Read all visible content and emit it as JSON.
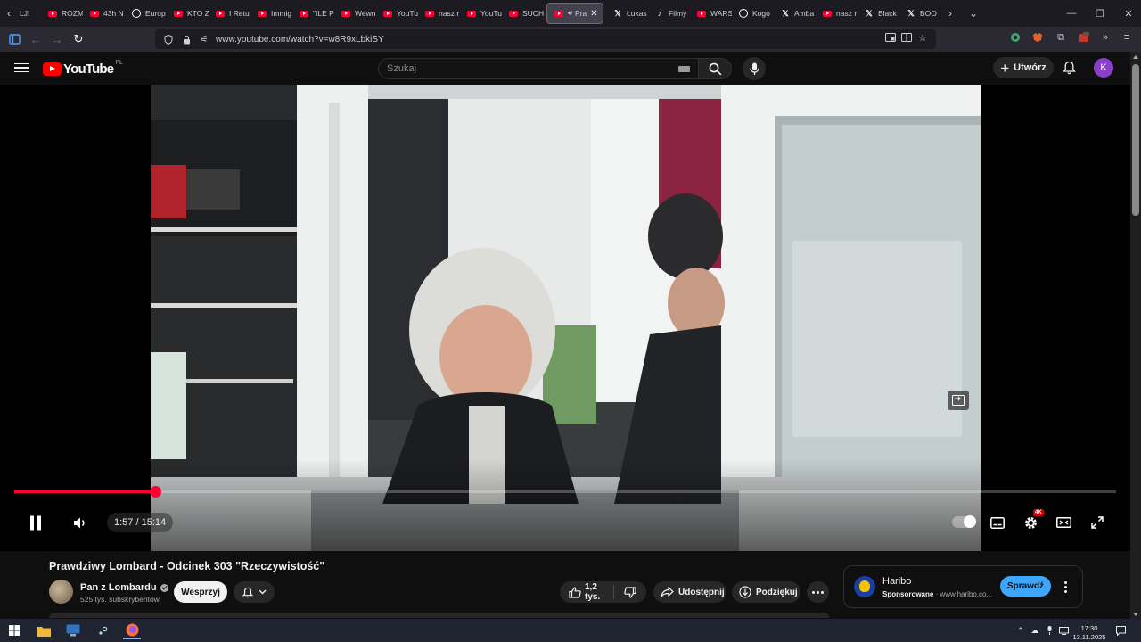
{
  "browser": {
    "tabs": [
      {
        "label": "LJ!",
        "icon": "scroll-left-icon"
      },
      {
        "label": "ROZM",
        "icon": "youtube-favicon"
      },
      {
        "label": "43h N",
        "icon": "youtube-favicon"
      },
      {
        "label": "Europ",
        "icon": "circle-favicon"
      },
      {
        "label": "KTO Z",
        "icon": "youtube-favicon"
      },
      {
        "label": "I Retu",
        "icon": "youtube-favicon"
      },
      {
        "label": "Immig",
        "icon": "youtube-favicon"
      },
      {
        "label": "\"ILE P",
        "icon": "youtube-favicon"
      },
      {
        "label": "Wewn",
        "icon": "youtube-favicon"
      },
      {
        "label": "YouTu",
        "icon": "youtube-favicon"
      },
      {
        "label": "nasz r",
        "icon": "youtube-favicon"
      },
      {
        "label": "YouTu",
        "icon": "youtube-favicon"
      },
      {
        "label": "SUCH",
        "icon": "youtube-favicon"
      },
      {
        "label": "Pra",
        "icon": "youtube-favicon",
        "active": true
      },
      {
        "label": "Łukas",
        "icon": "x-favicon"
      },
      {
        "label": "Filmy",
        "icon": "tiktok-favicon"
      },
      {
        "label": "WARS",
        "icon": "youtube-favicon"
      },
      {
        "label": "Kogo",
        "icon": "circle-favicon"
      },
      {
        "label": "Amba",
        "icon": "x-favicon"
      },
      {
        "label": "nasz r",
        "icon": "youtube-favicon"
      },
      {
        "label": "Black",
        "icon": "x-favicon"
      },
      {
        "label": "BOO",
        "icon": "x-favicon"
      }
    ],
    "url": "www.youtube.com/watch?v=w8R9xLbkiSY"
  },
  "youtube": {
    "logo_text": "YouTube",
    "country_code": "PL",
    "search_placeholder": "Szukaj",
    "create_label": "Utwórz",
    "avatar_letter": "K"
  },
  "player": {
    "current_time": "1:57",
    "duration": "15:14",
    "time_display": "1:57 / 15:14",
    "progress_fraction": 0.128,
    "quality_badge": "4K"
  },
  "video_info": {
    "title": "Prawdziwy Lombard - Odcinek 303 \"Rzeczywistość\"",
    "channel_name": "Pan z Lombardu",
    "subscribers": "525 tys. subskrybentów",
    "support_label": "Wesprzyj",
    "likes": "1,2 tys.",
    "share_label": "Udostępnij",
    "thanks_label": "Podziękuj"
  },
  "ad": {
    "title": "Haribo",
    "sponsored_label": "Sponsorowane",
    "domain": "www.haribo.co...",
    "cta_label": "Sprawdź"
  },
  "taskbar": {
    "time": "17:30",
    "date": "13.11.2025"
  },
  "colors": {
    "accent_red": "#ff0033",
    "cta_blue": "#3ea6ff",
    "avatar_purple": "#8a3fcb"
  }
}
